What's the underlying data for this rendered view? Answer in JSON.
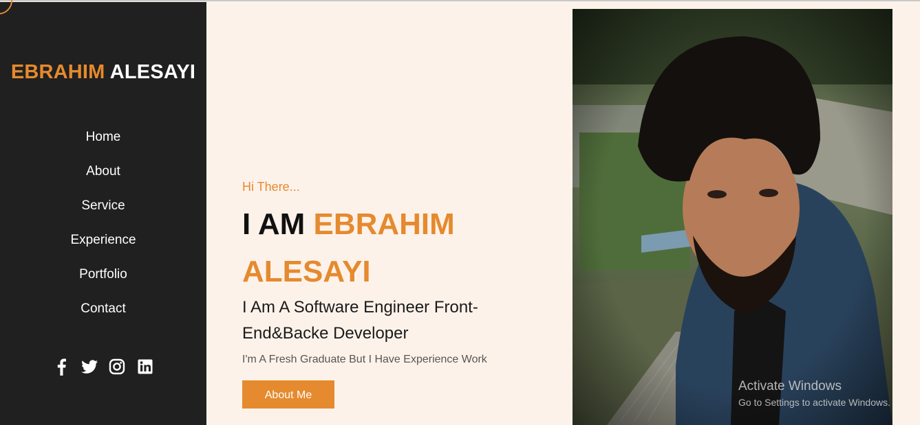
{
  "sidebar": {
    "logo_first": "EBRAHIM",
    "logo_last": "ALESAYI",
    "nav": [
      {
        "label": "Home"
      },
      {
        "label": "About"
      },
      {
        "label": "Service"
      },
      {
        "label": "Experience"
      },
      {
        "label": "Portfolio"
      },
      {
        "label": "Contact"
      }
    ],
    "social_icons": [
      "facebook-icon",
      "twitter-icon",
      "instagram-icon",
      "linkedin-icon"
    ]
  },
  "hero": {
    "greeting": "Hi There...",
    "headline_prefix": "I AM",
    "headline_name": "EBRAHIM ALESAYI",
    "role": "I Am A Software Engineer Front-End&Backe Developer",
    "subtitle": "I'm A Fresh Graduate But I Have Experience Work",
    "button_label": "About Me"
  },
  "watermark": {
    "title": "Activate Windows",
    "subtitle": "Go to Settings to activate Windows."
  },
  "colors": {
    "accent": "#e58a2e",
    "sidebar_bg": "#202020",
    "page_bg": "#fdf2ea"
  }
}
